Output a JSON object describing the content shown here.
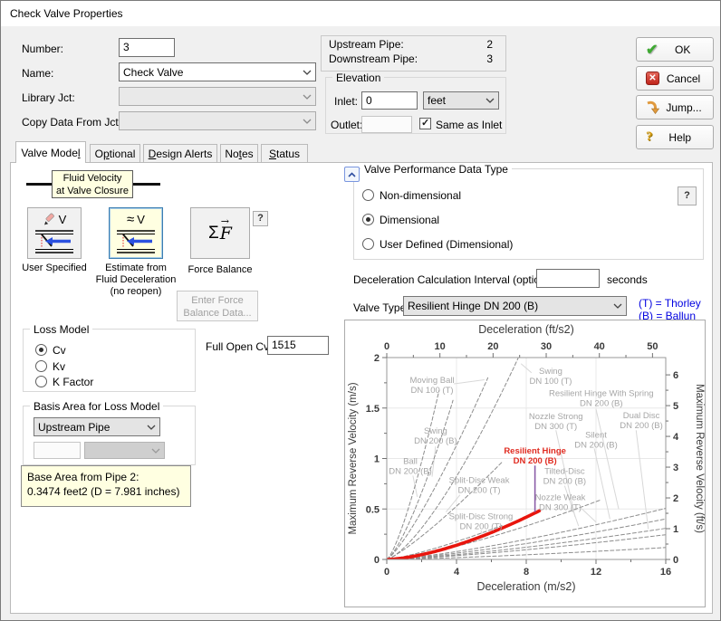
{
  "window": {
    "title": "Check Valve Properties"
  },
  "header": {
    "number_label": "Number:",
    "number_value": "3",
    "name_label": "Name:",
    "name_value": "Check Valve",
    "library_label": "Library Jct:",
    "copy_label": "Copy Data From Jct..."
  },
  "pipes": {
    "upstream_label": "Upstream Pipe:",
    "upstream_value": "2",
    "downstream_label": "Downstream Pipe:",
    "downstream_value": "3"
  },
  "elevation": {
    "title": "Elevation",
    "inlet_label": "Inlet:",
    "inlet_value": "0",
    "inlet_unit": "feet",
    "outlet_label": "Outlet:",
    "same_label": "Same as Inlet",
    "same_checked": true
  },
  "action_buttons": {
    "ok": "OK",
    "cancel": "Cancel",
    "jump": "Jump...",
    "help": "Help"
  },
  "tabs": [
    {
      "pre": "Valve Mode",
      "u": "l",
      "post": ""
    },
    {
      "pre": "O",
      "u": "p",
      "post": "tional"
    },
    {
      "pre": "",
      "u": "D",
      "post": "esign Alerts"
    },
    {
      "pre": "No",
      "u": "t",
      "post": "es"
    },
    {
      "pre": "",
      "u": "S",
      "post": "tatus"
    }
  ],
  "valve_model": {
    "tooltip_line1": "Fluid Velocity",
    "tooltip_line2": "at Valve Closure",
    "user_label": "User Specified",
    "estimate_label1": "Estimate from",
    "estimate_label2": "Fluid Deceleration",
    "estimate_label3": "(no reopen)",
    "force_label": "Force Balance",
    "help": "?",
    "enter_force_line1": "Enter Force",
    "enter_force_line2": "Balance Data..."
  },
  "performance": {
    "title": "Valve Performance Data Type",
    "options": [
      "Non-dimensional",
      "Dimensional",
      "User Defined (Dimensional)"
    ],
    "selected": "Dimensional",
    "help": "?"
  },
  "interval": {
    "label": "Deceleration Calculation Interval (optional):",
    "value": "",
    "unit": "seconds"
  },
  "valve_type": {
    "label": "Valve Type:",
    "value": "Resilient Hinge DN 200 (B)",
    "legend1": "(T) = Thorley",
    "legend2": "(B) = Ballun"
  },
  "loss_model": {
    "title": "Loss Model",
    "options": [
      "Cv",
      "Kv",
      "K Factor"
    ],
    "selected": "Cv",
    "full_open_label": "Full Open Cv:",
    "full_open_value": "1515"
  },
  "basis_area": {
    "title": "Basis Area for Loss Model",
    "value": "Upstream Pipe"
  },
  "base_area": {
    "line1": "Base Area from Pipe 2:",
    "line2": "0.3474 feet2 (D = 7.981 inches)"
  },
  "chart_data": {
    "type": "line",
    "top_axis": {
      "title": "Deceleration (ft/s2)",
      "ticks": [
        0,
        10,
        20,
        30,
        40,
        50
      ]
    },
    "bottom_axis": {
      "title": "Deceleration (m/s2)",
      "ticks": [
        0,
        4,
        8,
        12,
        16
      ],
      "range": [
        0,
        16
      ]
    },
    "left_axis": {
      "title": "Maximum Reverse Velocity (m/s)",
      "ticks": [
        0,
        0.5,
        1,
        1.5,
        2
      ],
      "range": [
        0,
        2
      ]
    },
    "right_axis": {
      "title": "Maximum Reverse Velocity (ft/s)",
      "ticks": [
        0,
        1,
        2,
        3,
        4,
        5,
        6
      ]
    },
    "unit_factor": 3.2808,
    "selected_series": "Resilient Hinge DN 200 (B)",
    "series": [
      {
        "name": "Ball DN 200 (B)",
        "a": 0.38,
        "b": 1.35,
        "xmax": 3.0,
        "style": "dashed"
      },
      {
        "name": "Swing DN 200 (B)",
        "a": 0.26,
        "b": 1.35,
        "xmax": 3.8,
        "style": "dashed"
      },
      {
        "name": "Moving Ball DN 100 (T)",
        "a": 0.2,
        "b": 1.25,
        "xmax": 5.8,
        "style": "dashed"
      },
      {
        "name": "Swing DN 100 (T)",
        "a": 0.118,
        "b": 1.4,
        "xmax": 7.62,
        "style": "dashed"
      },
      {
        "name": "Split-Disc Weak DN 200 (T)",
        "a": 0.1,
        "b": 1.2,
        "xmax": 6.6,
        "style": "dashed"
      },
      {
        "name": "Split-Disc Strong DN 200 (T)",
        "a": 0.03,
        "b": 1.28,
        "xmax": 6.6,
        "style": "dashed"
      },
      {
        "name": "Tilted-Disc DN 200 (B)",
        "a": 0.02,
        "b": 1.35,
        "xmax": 12.3,
        "style": "dashed"
      },
      {
        "name": "Nozzle Weak DN 300 (T)",
        "a": 0.012,
        "b": 1.35,
        "xmax": 16,
        "style": "dashed"
      },
      {
        "name": "Nozzle Strong DN 300 (T)",
        "a": 0.0095,
        "b": 1.35,
        "xmax": 16,
        "style": "dashed"
      },
      {
        "name": "Silent DN 200 (B)",
        "a": 0.0073,
        "b": 1.35,
        "xmax": 16,
        "style": "dashed"
      },
      {
        "name": "Dual Disc DN 200 (B)",
        "a": 0.0058,
        "b": 1.35,
        "xmax": 16,
        "style": "dashed"
      },
      {
        "name": "Resilient Hinge With Spring DN 200 (B)",
        "a": 0.0028,
        "b": 1.35,
        "xmax": 16,
        "style": "dashed"
      },
      {
        "name": "Resilient Hinge DN 200 (B)",
        "a": 0.016,
        "b": 1.57,
        "xmax": 8.75,
        "style": "red"
      }
    ],
    "marker": {
      "x": 8.5,
      "y1": 0.47,
      "y2": 0.93,
      "color": "#8B5CA8"
    },
    "labels": [
      {
        "lines": [
          "Moving Ball",
          "DN 100 (T)"
        ],
        "x": 2.6,
        "y": 1.73,
        "leader": [
          3.85,
          1.74,
          5.6,
          1.78
        ]
      },
      {
        "lines": [
          "Swing",
          "DN 100 (T)"
        ],
        "x": 9.4,
        "y": 1.82,
        "leader": [
          8.3,
          1.85,
          7.7,
          1.94
        ]
      },
      {
        "lines": [
          "Resilient Hinge With Spring",
          "DN 200 (B)"
        ],
        "x": 12.3,
        "y": 1.6,
        "leader": [
          12.0,
          1.49,
          13.3,
          0.5
        ]
      },
      {
        "lines": [
          "Nozzle Strong",
          "DN 300 (T)"
        ],
        "x": 9.7,
        "y": 1.37,
        "leader": [
          9.7,
          1.28,
          10.8,
          0.42
        ]
      },
      {
        "lines": [
          "Silent",
          "DN 200 (B)"
        ],
        "x": 12.0,
        "y": 1.19,
        "leader": [
          11.9,
          1.1,
          12.8,
          0.4
        ]
      },
      {
        "lines": [
          "Dual Disc",
          "DN 200 (B)"
        ],
        "x": 14.6,
        "y": 1.38,
        "leader": [
          14.3,
          1.28,
          15.0,
          0.3
        ]
      },
      {
        "lines": [
          "Swing",
          "DN 200 (B)"
        ],
        "x": 2.8,
        "y": 1.23,
        "leader": [
          2.8,
          1.12,
          2.6,
          0.82
        ]
      },
      {
        "lines": [
          "Ball",
          "DN 200 (B)"
        ],
        "x": 1.35,
        "y": 0.93,
        "leader": [
          1.5,
          0.83,
          1.75,
          0.62
        ]
      },
      {
        "lines": [
          "Split-Disc Weak",
          "DN 200 (T)"
        ],
        "x": 5.3,
        "y": 0.74,
        "leader": [
          4.2,
          0.64,
          3.4,
          0.47
        ]
      },
      {
        "lines": [
          "Resilient Hinge",
          "DN 200 (B)"
        ],
        "x": 8.5,
        "y": 1.03,
        "color": "#E02B20"
      },
      {
        "lines": [
          "Tilted-Disc",
          "DN 200 (B)"
        ],
        "x": 10.2,
        "y": 0.83,
        "leader": [
          10.2,
          0.73,
          11.0,
          0.33
        ]
      },
      {
        "lines": [
          "Nozzle Weak",
          "DN 300 (T)"
        ],
        "x": 9.95,
        "y": 0.57,
        "leader": [
          11.2,
          0.5,
          12.0,
          0.37
        ]
      },
      {
        "lines": [
          "Split-Disc Strong",
          "DN 200 (T)"
        ],
        "x": 5.4,
        "y": 0.38,
        "leader": [
          5.4,
          0.29,
          5.5,
          0.23
        ]
      }
    ],
    "colors": {
      "curve": "#8C8C8C",
      "selected": "#E8150D",
      "label": "#A6A6A6",
      "grid": "#E8E8E8"
    }
  }
}
